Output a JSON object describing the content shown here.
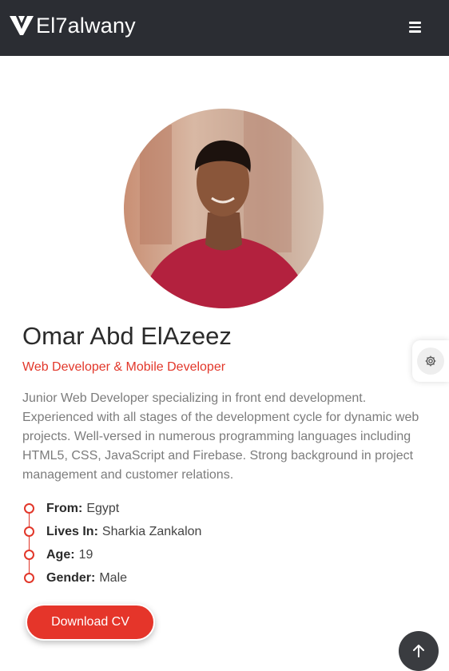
{
  "navbar": {
    "brand": "El7alwany",
    "logo_icon": "v-logo-icon",
    "menu_icon": "hamburger-menu-icon"
  },
  "profile": {
    "name": "Omar Abd ElAzeez",
    "role": "Web Developer & Mobile Developer",
    "bio": "Junior Web Developer specializing in front end development. Experienced with all stages of the development cycle for dynamic web projects. Well-versed in numerous programming languages including HTML5, CSS, JavaScript and Firebase. Strong background in project management and customer relations.",
    "info": [
      {
        "key": "From:",
        "value": "Egypt"
      },
      {
        "key": "Lives In:",
        "value": "Sharkia Zankalon"
      },
      {
        "key": "Age:",
        "value": "19"
      },
      {
        "key": "Gender:",
        "value": "Male"
      }
    ],
    "cv_button": "Download CV"
  },
  "widgets": {
    "settings_icon": "gear-icon",
    "scroll_top_icon": "arrow-up-icon"
  },
  "colors": {
    "accent": "#e2372a",
    "navbar": "#2b2d33"
  }
}
